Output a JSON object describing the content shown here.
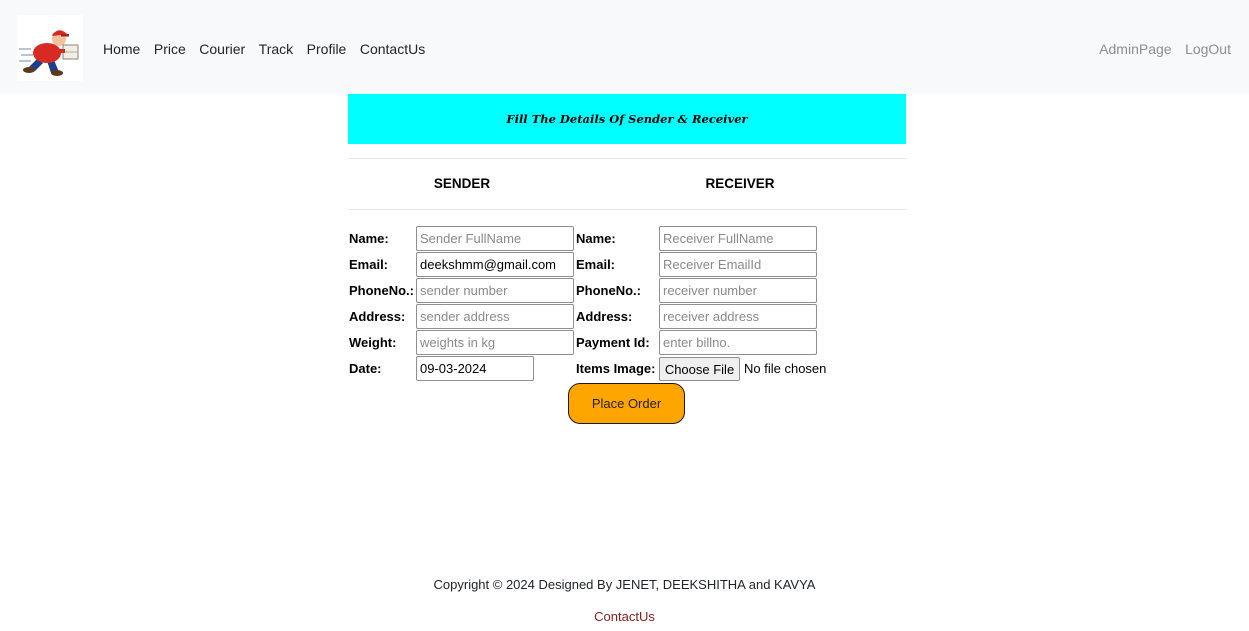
{
  "navbar": {
    "logo_icon": "delivery-courier-logo",
    "links": [
      "Home",
      "Price",
      "Courier",
      "Track",
      "Profile",
      "ContactUs"
    ],
    "right_links": [
      "AdminPage",
      "LogOut"
    ]
  },
  "banner": {
    "text": "Fill The Details Of Sender & Receiver",
    "color": "#00ffff"
  },
  "columns": {
    "sender": "SENDER",
    "receiver": "RECEIVER"
  },
  "sender": {
    "name_label": "Name:",
    "name_placeholder": "Sender FullName",
    "email_label": "Email:",
    "email_value": "deekshmm@gmail.com",
    "phone_label": "PhoneNo.:",
    "phone_placeholder": "sender number",
    "address_label": "Address:",
    "address_placeholder": "sender address",
    "weight_label": "Weight:",
    "weight_placeholder": "weights in kg",
    "date_label": "Date:",
    "date_value": "09-03-2024"
  },
  "receiver": {
    "name_label": "Name:",
    "name_placeholder": "Receiver FullName",
    "email_label": "Email:",
    "email_placeholder": "Receiver EmailId",
    "phone_label": "PhoneNo.:",
    "phone_placeholder": "receiver number",
    "address_label": "Address:",
    "address_placeholder": "receiver address",
    "payment_label": "Payment Id:",
    "payment_placeholder": "enter billno.",
    "image_label": "Items Image:",
    "file_button": "Choose File",
    "file_status": "No file chosen"
  },
  "place_order": {
    "label": "Place Order",
    "color": "#ffa500"
  },
  "footer": {
    "copyright": "Copyright © 2024 Designed By JENET, DEEKSHITHA and KAVYA",
    "link": "ContactUs"
  }
}
